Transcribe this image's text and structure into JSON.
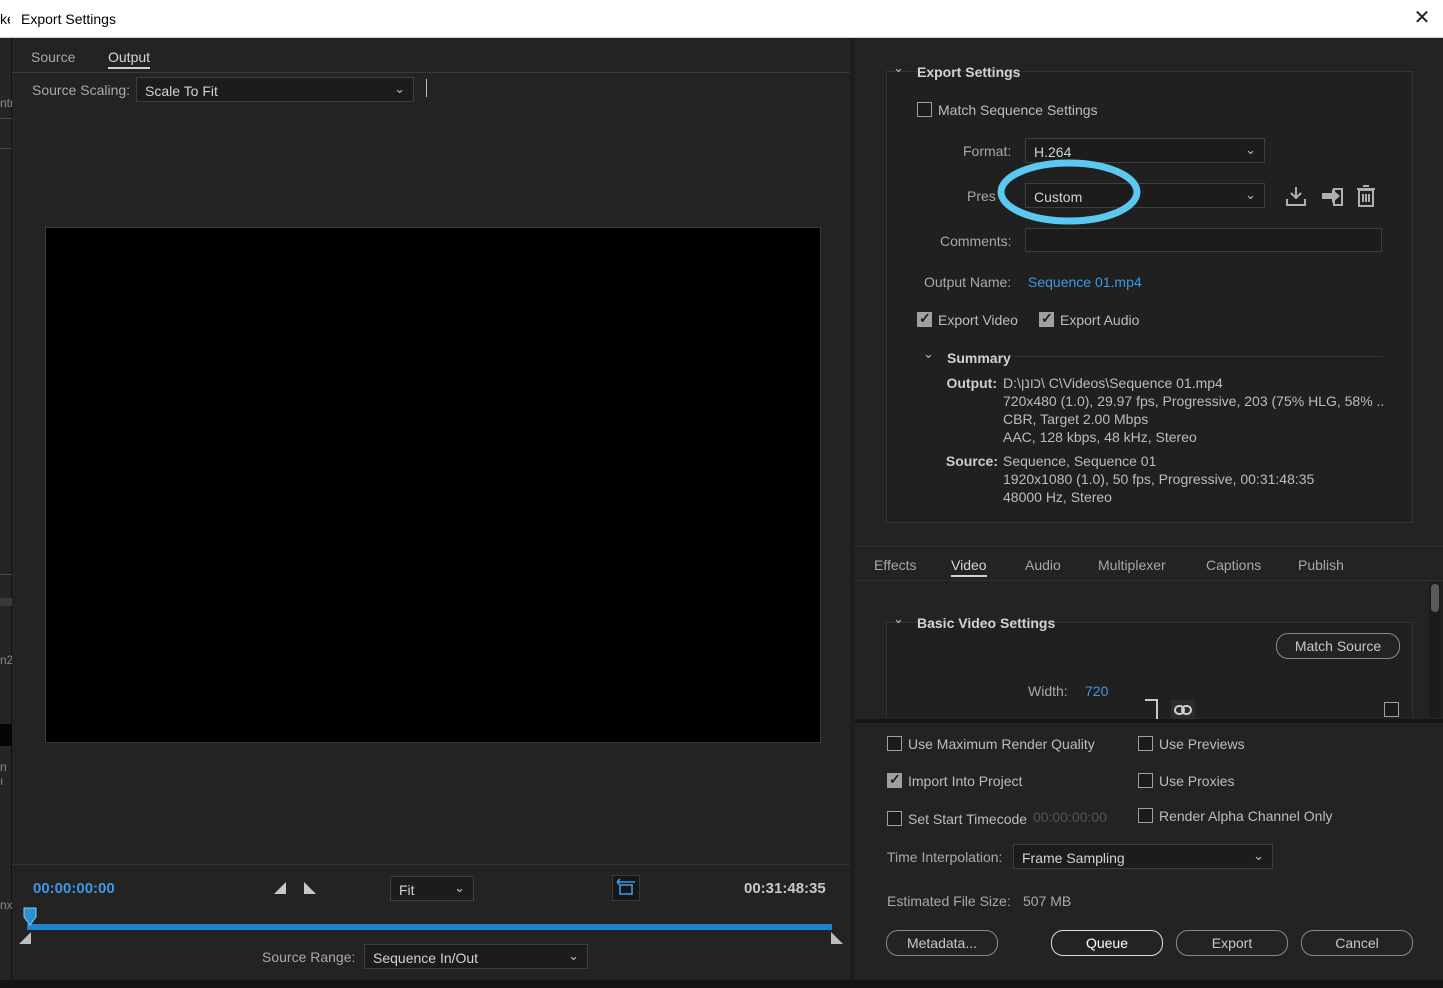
{
  "window": {
    "title": "Export Settings",
    "left_fragment": "ke",
    "close_glyph": "✕"
  },
  "behind_fragments": [
    "ntr",
    "n2",
    "n ı",
    "nx"
  ],
  "left": {
    "tabs": [
      {
        "label": "Source",
        "active": false
      },
      {
        "label": "Output",
        "active": true
      }
    ],
    "source_scaling_label": "Source Scaling:",
    "source_scaling_value": "Scale To Fit",
    "timecode_in": "00:00:00:00",
    "timecode_out": "00:31:48:35",
    "zoom_value": "Fit",
    "source_range_label": "Source Range:",
    "source_range_value": "Sequence In/Out"
  },
  "export_settings": {
    "section_title": "Export Settings",
    "match_sequence_label": "Match Sequence Settings",
    "match_sequence_checked": false,
    "format_label": "Format:",
    "format_value": "H.264",
    "preset_label": "Pres",
    "preset_value": "Custom",
    "comments_label": "Comments:",
    "comments_value": "",
    "output_name_label": "Output Name:",
    "output_name_value": "Sequence 01.mp4",
    "export_video_label": "Export Video",
    "export_video_checked": true,
    "export_audio_label": "Export Audio",
    "export_audio_checked": true,
    "summary_title": "Summary",
    "output_key": "Output:",
    "output_lines": [
      "D:\\כונן\\ C\\Videos\\Sequence 01.mp4",
      "720x480 (1.0), 29.97 fps, Progressive, 203 (75% HLG, 58% ...",
      "CBR, Target 2.00 Mbps",
      "AAC, 128 kbps, 48 kHz, Stereo"
    ],
    "source_key": "Source:",
    "source_lines": [
      "Sequence, Sequence 01",
      "1920x1080 (1.0), 50 fps, Progressive, 00:31:48:35",
      "48000 Hz, Stereo"
    ]
  },
  "settings_tabs": [
    {
      "label": "Effects",
      "active": false
    },
    {
      "label": "Video",
      "active": true
    },
    {
      "label": "Audio",
      "active": false
    },
    {
      "label": "Multiplexer",
      "active": false
    },
    {
      "label": "Captions",
      "active": false
    },
    {
      "label": "Publish",
      "active": false
    }
  ],
  "video_settings": {
    "section_title": "Basic Video Settings",
    "match_source_label": "Match Source",
    "width_label": "Width:",
    "width_value": "720"
  },
  "bottom": {
    "use_max_render_label": "Use Maximum Render Quality",
    "use_max_render_checked": false,
    "use_previews_label": "Use Previews",
    "use_previews_checked": false,
    "import_project_label": "Import Into Project",
    "import_project_checked": true,
    "use_proxies_label": "Use Proxies",
    "use_proxies_checked": false,
    "set_start_tc_label": "Set Start Timecode",
    "set_start_tc_checked": false,
    "start_tc_value": "00:00:00:00",
    "render_alpha_label": "Render Alpha Channel Only",
    "render_alpha_checked": false,
    "time_interp_label": "Time Interpolation:",
    "time_interp_value": "Frame Sampling",
    "est_size_label": "Estimated File Size:",
    "est_size_value": "507 MB",
    "metadata_label": "Metadata...",
    "queue_label": "Queue",
    "export_label": "Export",
    "cancel_label": "Cancel"
  },
  "colors": {
    "annotation_highlight": "#5bc8f0",
    "accent_blue": "#3f97e4",
    "playhead_blue": "#2b8fd6"
  }
}
